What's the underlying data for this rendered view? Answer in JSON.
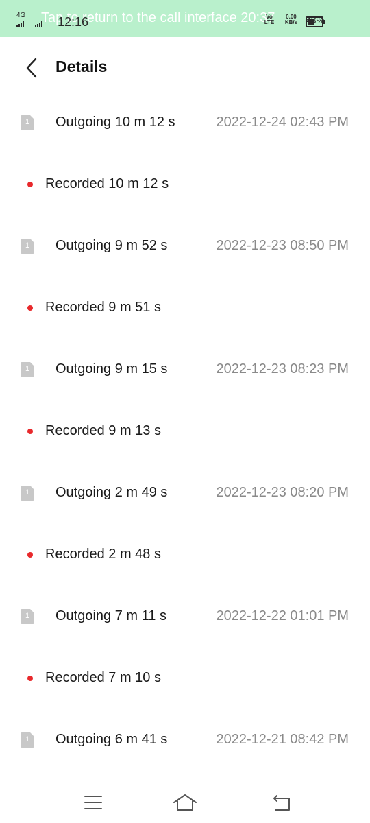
{
  "status_bar": {
    "network": "4G",
    "time": "12:16",
    "banner": "Tap to return to the call interface 20:37",
    "volte": "Vo LTE",
    "data_speed": "0.00 KB/s",
    "battery_percent": "43%",
    "battery_level": 0.43,
    "background": "#b9f0cc"
  },
  "header": {
    "title": "Details"
  },
  "entries": [
    {
      "sim": "1",
      "type": "Outgoing",
      "duration": "Outgoing 10 m 12 s",
      "datetime": "2022-12-24  02:43 PM",
      "recording": "Recorded 10 m 12 s"
    },
    {
      "sim": "1",
      "type": "Outgoing",
      "duration": "Outgoing 9 m 52 s",
      "datetime": "2022-12-23  08:50 PM",
      "recording": "Recorded 9 m 51 s"
    },
    {
      "sim": "1",
      "type": "Outgoing",
      "duration": "Outgoing 9 m 15 s",
      "datetime": "2022-12-23  08:23 PM",
      "recording": "Recorded 9 m 13 s"
    },
    {
      "sim": "1",
      "type": "Outgoing",
      "duration": "Outgoing 2 m 49 s",
      "datetime": "2022-12-23  08:20 PM",
      "recording": "Recorded 2 m 48 s"
    },
    {
      "sim": "1",
      "type": "Outgoing",
      "duration": "Outgoing 7 m 11 s",
      "datetime": "2022-12-22  01:01 PM",
      "recording": "Recorded 7 m 10 s"
    },
    {
      "sim": "1",
      "type": "Outgoing",
      "duration": "Outgoing 6 m 41 s",
      "datetime": "2022-12-21  08:42 PM",
      "recording": null
    }
  ],
  "nav": {
    "icons": [
      "menu-icon",
      "home-icon",
      "back-icon"
    ]
  },
  "colors": {
    "record_dot": "#e8292c",
    "sim_badge": "#c8c8c8",
    "time_text": "#8a8a8a"
  }
}
